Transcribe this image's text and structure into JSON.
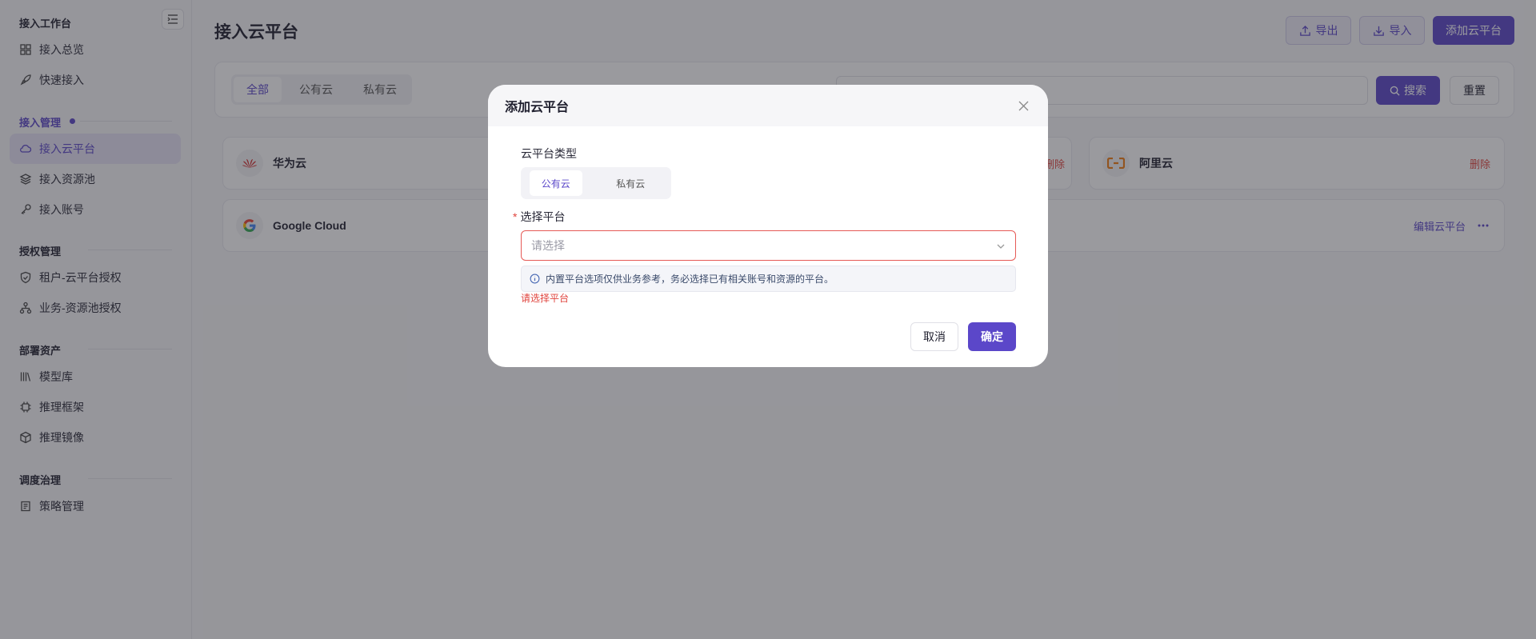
{
  "sidebar": {
    "sections": [
      {
        "title": "接入工作台",
        "items": [
          {
            "label": "接入总览",
            "icon": "grid-icon"
          },
          {
            "label": "快速接入",
            "icon": "rocket-icon"
          }
        ]
      },
      {
        "title": "接入管理",
        "items": [
          {
            "label": "接入云平台",
            "icon": "cloud-icon"
          },
          {
            "label": "接入资源池",
            "icon": "layers-icon"
          },
          {
            "label": "接入账号",
            "icon": "key-icon"
          }
        ]
      },
      {
        "title": "授权管理",
        "items": [
          {
            "label": "租户-云平台授权",
            "icon": "shield-icon"
          },
          {
            "label": "业务-资源池授权",
            "icon": "hierarchy-icon"
          }
        ]
      },
      {
        "title": "部署资产",
        "items": [
          {
            "label": "模型库",
            "icon": "library-icon"
          },
          {
            "label": "推理框架",
            "icon": "chip-icon"
          },
          {
            "label": "推理镜像",
            "icon": "box-icon"
          }
        ]
      },
      {
        "title": "调度治理",
        "items": [
          {
            "label": "策略管理",
            "icon": "policy-icon"
          }
        ]
      }
    ],
    "active_item": "接入云平台"
  },
  "header": {
    "title": "接入云平台",
    "export_label": "导出",
    "import_label": "导入",
    "add_label": "添加云平台"
  },
  "filter": {
    "tabs": [
      "全部",
      "公有云",
      "私有云"
    ],
    "active_tab": "全部",
    "search_label": "搜索",
    "reset_label": "重置"
  },
  "cards": [
    {
      "name": "华为云",
      "action": "删除",
      "logo": "huawei-logo-icon"
    },
    {
      "name": "阿里云",
      "action": "删除",
      "logo": "aliyun-logo-icon"
    },
    {
      "name": "Google Cloud",
      "action": "编辑云平台",
      "logo": "google-logo-icon"
    }
  ],
  "modal": {
    "title": "添加云平台",
    "type_label": "云平台类型",
    "type_options": [
      "公有云",
      "私有云"
    ],
    "type_selected": "公有云",
    "platform_required_mark": "*",
    "platform_label": "选择平台",
    "platform_placeholder": "请选择",
    "tip": "内置平台选项仅供业务参考，务必选择已有相关账号和资源的平台。",
    "error": "请选择平台",
    "cancel_label": "取消",
    "ok_label": "确定"
  },
  "colors": {
    "accent": "#5b47c9",
    "danger": "#e0443e",
    "active_nav_bg": "#e6e3f5"
  }
}
